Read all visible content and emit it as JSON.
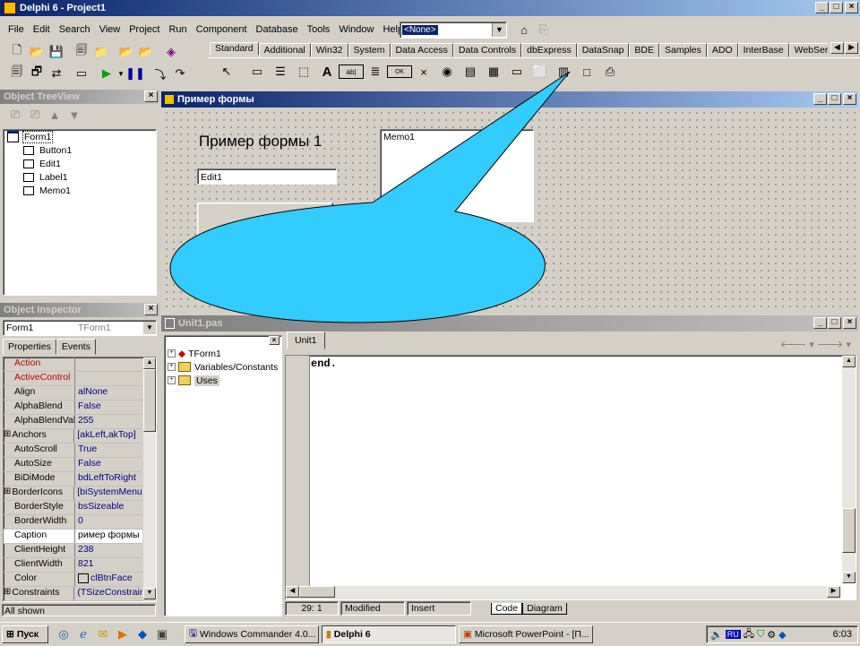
{
  "main_window": {
    "title": "Delphi 6 - Project1",
    "menu": [
      "File",
      "Edit",
      "Search",
      "View",
      "Project",
      "Run",
      "Component",
      "Database",
      "Tools",
      "Window",
      "Help"
    ],
    "config_combo": "<None>"
  },
  "palette": {
    "tabs": [
      "Standard",
      "Additional",
      "Win32",
      "System",
      "Data Access",
      "Data Controls",
      "dbExpress",
      "DataSnap",
      "BDE",
      "Samples",
      "ADO",
      "InterBase",
      "WebServices"
    ],
    "component_glyphs": [
      "A",
      "ab|",
      "OK",
      "×",
      "◉"
    ]
  },
  "tree_view": {
    "title": "Object TreeView",
    "items": [
      "Form1",
      "Button1",
      "Edit1",
      "Label1",
      "Memo1"
    ]
  },
  "inspector": {
    "title": "Object Inspector",
    "object_name": "Form1",
    "object_type": "TForm1",
    "tabs": [
      "Properties",
      "Events"
    ],
    "rows": [
      {
        "name": "Action",
        "value": "",
        "red": true
      },
      {
        "name": "ActiveControl",
        "value": "",
        "red": true
      },
      {
        "name": "Align",
        "value": "alNone"
      },
      {
        "name": "AlphaBlend",
        "value": "False"
      },
      {
        "name": "AlphaBlendValı",
        "value": "255"
      },
      {
        "name": "Anchors",
        "value": "[akLeft,akTop]",
        "expand": true
      },
      {
        "name": "AutoScroll",
        "value": "True"
      },
      {
        "name": "AutoSize",
        "value": "False"
      },
      {
        "name": "BiDiMode",
        "value": "bdLeftToRight"
      },
      {
        "name": "BorderIcons",
        "value": "[biSystemMenu,",
        "expand": true
      },
      {
        "name": "BorderStyle",
        "value": "bsSizeable"
      },
      {
        "name": "BorderWidth",
        "value": "0"
      },
      {
        "name": "Caption",
        "value": "ример формы",
        "selected": true
      },
      {
        "name": "ClientHeight",
        "value": "238"
      },
      {
        "name": "ClientWidth",
        "value": "821"
      },
      {
        "name": "Color",
        "value": "clBtnFace",
        "swatch": true
      },
      {
        "name": "Constraints",
        "value": "(TSizeConstrain",
        "expand": true
      },
      {
        "name": "Ctl3D",
        "value": "True"
      }
    ],
    "status": "All shown"
  },
  "form_designer": {
    "title": "Пример формы",
    "label_text": "Пример формы 1",
    "edit_text": "Edit1",
    "memo_text": "Memo1"
  },
  "editor": {
    "title": "Unit1.pas",
    "tab": "Unit1",
    "explorer_items": [
      "TForm1",
      "Variables/Constants",
      "Uses"
    ],
    "code": "end.",
    "status": {
      "position": "29:  1",
      "modified": "Modified",
      "mode": "Insert",
      "tab_code": "Code",
      "tab_diagram": "Diagram"
    }
  },
  "taskbar": {
    "start": "Пуск",
    "tasks": [
      "Windows Commander 4.0...",
      "Delphi 6",
      "Microsoft PowerPoint - [П..."
    ],
    "lang": "RU",
    "clock": "6:03"
  },
  "colors": {
    "callout_fill": "#33ccff",
    "title_active": "#0a246a",
    "prop_value": "#000080"
  }
}
